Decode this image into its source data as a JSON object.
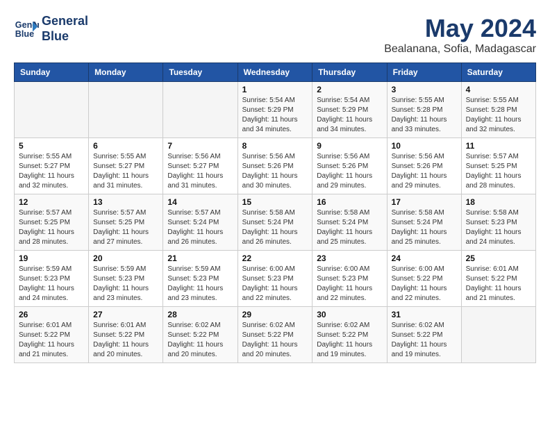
{
  "header": {
    "logo_line1": "General",
    "logo_line2": "Blue",
    "title": "May 2024",
    "subtitle": "Bealanana, Sofia, Madagascar"
  },
  "days_of_week": [
    "Sunday",
    "Monday",
    "Tuesday",
    "Wednesday",
    "Thursday",
    "Friday",
    "Saturday"
  ],
  "weeks": [
    [
      {
        "day": "",
        "detail": ""
      },
      {
        "day": "",
        "detail": ""
      },
      {
        "day": "",
        "detail": ""
      },
      {
        "day": "1",
        "detail": "Sunrise: 5:54 AM\nSunset: 5:29 PM\nDaylight: 11 hours\nand 34 minutes."
      },
      {
        "day": "2",
        "detail": "Sunrise: 5:54 AM\nSunset: 5:29 PM\nDaylight: 11 hours\nand 34 minutes."
      },
      {
        "day": "3",
        "detail": "Sunrise: 5:55 AM\nSunset: 5:28 PM\nDaylight: 11 hours\nand 33 minutes."
      },
      {
        "day": "4",
        "detail": "Sunrise: 5:55 AM\nSunset: 5:28 PM\nDaylight: 11 hours\nand 32 minutes."
      }
    ],
    [
      {
        "day": "5",
        "detail": "Sunrise: 5:55 AM\nSunset: 5:27 PM\nDaylight: 11 hours\nand 32 minutes."
      },
      {
        "day": "6",
        "detail": "Sunrise: 5:55 AM\nSunset: 5:27 PM\nDaylight: 11 hours\nand 31 minutes."
      },
      {
        "day": "7",
        "detail": "Sunrise: 5:56 AM\nSunset: 5:27 PM\nDaylight: 11 hours\nand 31 minutes."
      },
      {
        "day": "8",
        "detail": "Sunrise: 5:56 AM\nSunset: 5:26 PM\nDaylight: 11 hours\nand 30 minutes."
      },
      {
        "day": "9",
        "detail": "Sunrise: 5:56 AM\nSunset: 5:26 PM\nDaylight: 11 hours\nand 29 minutes."
      },
      {
        "day": "10",
        "detail": "Sunrise: 5:56 AM\nSunset: 5:26 PM\nDaylight: 11 hours\nand 29 minutes."
      },
      {
        "day": "11",
        "detail": "Sunrise: 5:57 AM\nSunset: 5:25 PM\nDaylight: 11 hours\nand 28 minutes."
      }
    ],
    [
      {
        "day": "12",
        "detail": "Sunrise: 5:57 AM\nSunset: 5:25 PM\nDaylight: 11 hours\nand 28 minutes."
      },
      {
        "day": "13",
        "detail": "Sunrise: 5:57 AM\nSunset: 5:25 PM\nDaylight: 11 hours\nand 27 minutes."
      },
      {
        "day": "14",
        "detail": "Sunrise: 5:57 AM\nSunset: 5:24 PM\nDaylight: 11 hours\nand 26 minutes."
      },
      {
        "day": "15",
        "detail": "Sunrise: 5:58 AM\nSunset: 5:24 PM\nDaylight: 11 hours\nand 26 minutes."
      },
      {
        "day": "16",
        "detail": "Sunrise: 5:58 AM\nSunset: 5:24 PM\nDaylight: 11 hours\nand 25 minutes."
      },
      {
        "day": "17",
        "detail": "Sunrise: 5:58 AM\nSunset: 5:24 PM\nDaylight: 11 hours\nand 25 minutes."
      },
      {
        "day": "18",
        "detail": "Sunrise: 5:58 AM\nSunset: 5:23 PM\nDaylight: 11 hours\nand 24 minutes."
      }
    ],
    [
      {
        "day": "19",
        "detail": "Sunrise: 5:59 AM\nSunset: 5:23 PM\nDaylight: 11 hours\nand 24 minutes."
      },
      {
        "day": "20",
        "detail": "Sunrise: 5:59 AM\nSunset: 5:23 PM\nDaylight: 11 hours\nand 23 minutes."
      },
      {
        "day": "21",
        "detail": "Sunrise: 5:59 AM\nSunset: 5:23 PM\nDaylight: 11 hours\nand 23 minutes."
      },
      {
        "day": "22",
        "detail": "Sunrise: 6:00 AM\nSunset: 5:23 PM\nDaylight: 11 hours\nand 22 minutes."
      },
      {
        "day": "23",
        "detail": "Sunrise: 6:00 AM\nSunset: 5:23 PM\nDaylight: 11 hours\nand 22 minutes."
      },
      {
        "day": "24",
        "detail": "Sunrise: 6:00 AM\nSunset: 5:22 PM\nDaylight: 11 hours\nand 22 minutes."
      },
      {
        "day": "25",
        "detail": "Sunrise: 6:01 AM\nSunset: 5:22 PM\nDaylight: 11 hours\nand 21 minutes."
      }
    ],
    [
      {
        "day": "26",
        "detail": "Sunrise: 6:01 AM\nSunset: 5:22 PM\nDaylight: 11 hours\nand 21 minutes."
      },
      {
        "day": "27",
        "detail": "Sunrise: 6:01 AM\nSunset: 5:22 PM\nDaylight: 11 hours\nand 20 minutes."
      },
      {
        "day": "28",
        "detail": "Sunrise: 6:02 AM\nSunset: 5:22 PM\nDaylight: 11 hours\nand 20 minutes."
      },
      {
        "day": "29",
        "detail": "Sunrise: 6:02 AM\nSunset: 5:22 PM\nDaylight: 11 hours\nand 20 minutes."
      },
      {
        "day": "30",
        "detail": "Sunrise: 6:02 AM\nSunset: 5:22 PM\nDaylight: 11 hours\nand 19 minutes."
      },
      {
        "day": "31",
        "detail": "Sunrise: 6:02 AM\nSunset: 5:22 PM\nDaylight: 11 hours\nand 19 minutes."
      },
      {
        "day": "",
        "detail": ""
      }
    ]
  ]
}
